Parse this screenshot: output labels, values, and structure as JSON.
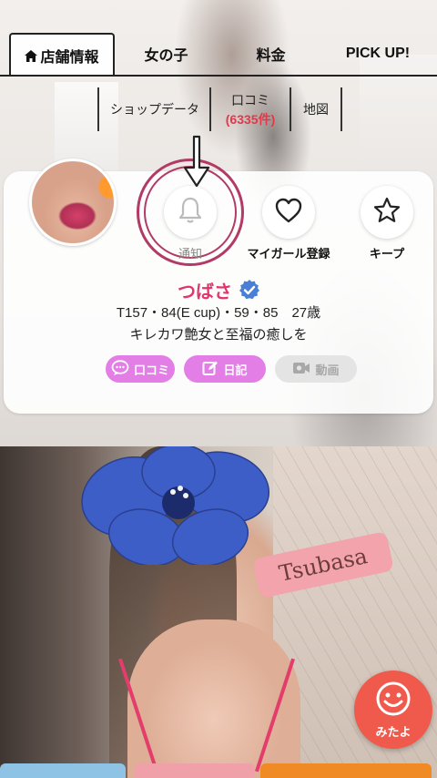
{
  "tabs": [
    {
      "label": "店舗情報",
      "active": true
    },
    {
      "label": "女の子"
    },
    {
      "label": "料金"
    },
    {
      "label": "PICK UP!"
    }
  ],
  "subnav": {
    "shop_data": "ショップデータ",
    "reviews_label": "口コミ",
    "reviews_count": "(6335件)",
    "map": "地図"
  },
  "profile": {
    "actions": {
      "notify": "通知",
      "favorite": "マイガール登録",
      "keep": "キープ"
    },
    "name": "つばさ",
    "stats": "T157・84(E cup)・59・85　27歳",
    "tagline": "キレカワ艶女と至福の癒しを",
    "buttons": {
      "reviews": "口コミ",
      "diary": "日記",
      "video": "動画"
    }
  },
  "photo": {
    "name_tag": "Tsubasa"
  },
  "floating": {
    "mitayo": "みたよ"
  },
  "colors": {
    "accent_pink": "#e0356f",
    "pill_purple": "#e27ee6",
    "review_count_red": "#e0394a",
    "highlight_ring": "#b23a67",
    "mitayo_orange": "#f05a4d"
  }
}
